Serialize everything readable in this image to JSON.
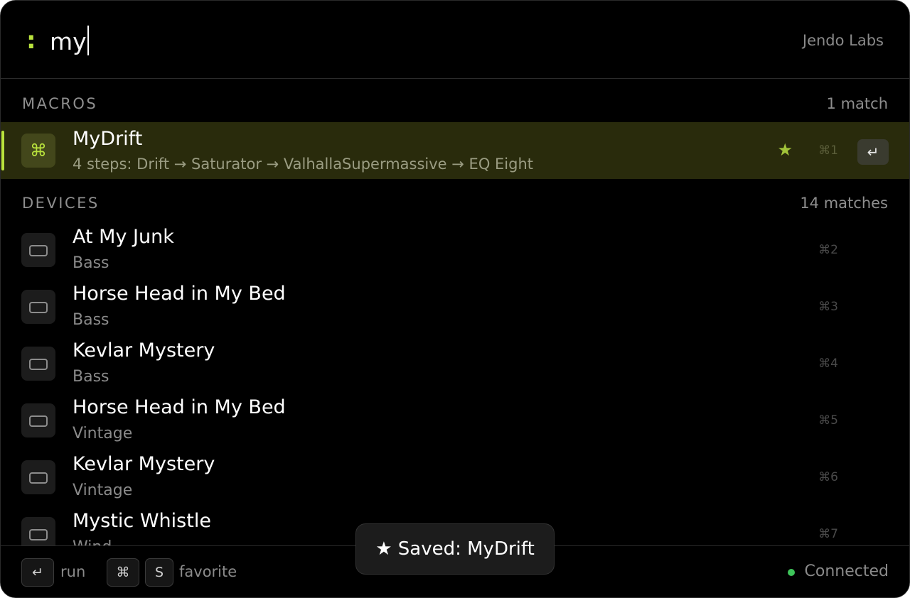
{
  "search": {
    "prompt": ":",
    "query": "my",
    "brand": "Jendo Labs"
  },
  "macros": {
    "title": "MACROS",
    "count": "1 match",
    "items": [
      {
        "icon": "command-icon",
        "glyph": "⌘",
        "title": "MyDrift",
        "subtitle": "4 steps: Drift → Saturator → ValhallaSupermassive → EQ Eight",
        "favorite": true,
        "favorite_glyph": "★",
        "shortcut": "⌘1",
        "enter_glyph": "↵"
      }
    ]
  },
  "devices": {
    "title": "DEVICES",
    "count": "14 matches",
    "items": [
      {
        "title": "At My Junk",
        "subtitle": "Bass",
        "shortcut": "⌘2"
      },
      {
        "title": "Horse Head in My Bed",
        "subtitle": "Bass",
        "shortcut": "⌘3"
      },
      {
        "title": "Kevlar Mystery",
        "subtitle": "Bass",
        "shortcut": "⌘4"
      },
      {
        "title": "Horse Head in My Bed",
        "subtitle": "Vintage",
        "shortcut": "⌘5"
      },
      {
        "title": "Kevlar Mystery",
        "subtitle": "Vintage",
        "shortcut": "⌘6"
      },
      {
        "title": "Mystic Whistle",
        "subtitle": "Wind",
        "shortcut": "⌘7"
      }
    ]
  },
  "footer": {
    "run_key": "↵",
    "run_label": "run",
    "fav_key1": "⌘",
    "fav_key2": "S",
    "fav_label": "favorite",
    "status_text": "Connected",
    "status_color": "#3ec45a"
  },
  "toast": {
    "text": "★ Saved: MyDrift"
  },
  "colors": {
    "accent": "#b9e23d",
    "selected_row": "#292b0c"
  }
}
